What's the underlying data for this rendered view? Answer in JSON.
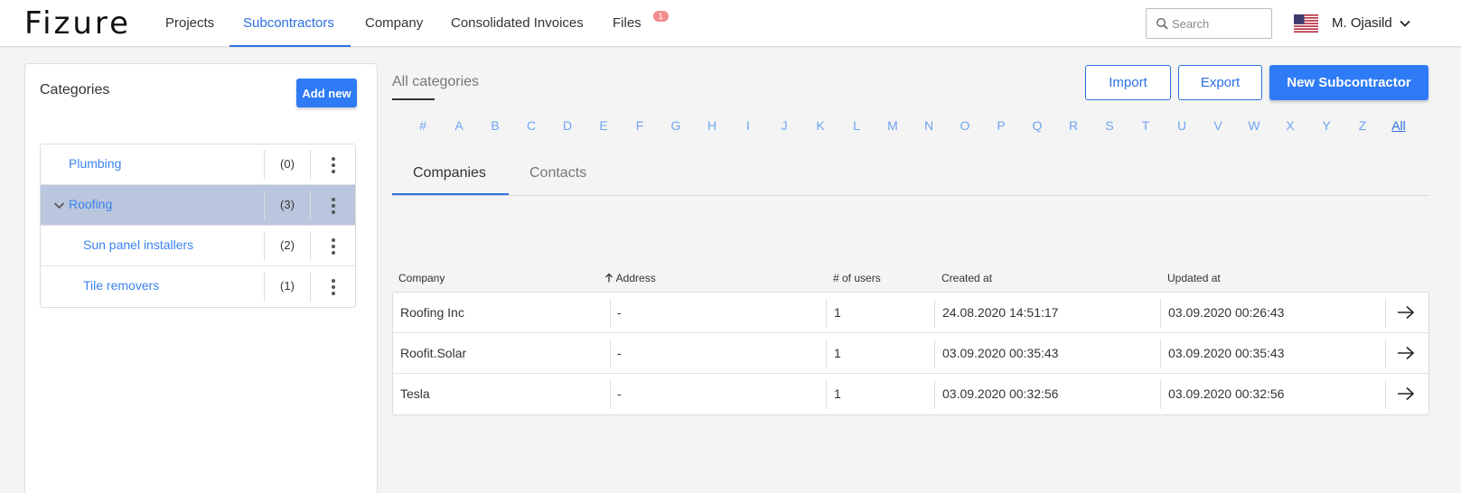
{
  "app": {
    "logo": "Fizure"
  },
  "nav": {
    "items": [
      {
        "label": "Projects"
      },
      {
        "label": "Subcontractors"
      },
      {
        "label": "Company"
      },
      {
        "label": "Consolidated Invoices"
      },
      {
        "label": "Files"
      }
    ],
    "files_badge": "1"
  },
  "search": {
    "placeholder": "Search"
  },
  "user": {
    "name": "M. Ojasild"
  },
  "sidebar": {
    "title": "Categories",
    "add_new_label": "Add new",
    "categories": [
      {
        "label": "Plumbing",
        "count": "(0)"
      },
      {
        "label": "Roofing",
        "count": "(3)"
      },
      {
        "label": "Sun panel installers",
        "count": "(2)"
      },
      {
        "label": "Tile removers",
        "count": "(1)"
      }
    ]
  },
  "main": {
    "title": "All categories",
    "import_label": "Import",
    "export_label": "Export",
    "new_label": "New Subcontractor",
    "alphabet": [
      "#",
      "A",
      "B",
      "C",
      "D",
      "E",
      "F",
      "G",
      "H",
      "I",
      "J",
      "K",
      "L",
      "M",
      "N",
      "O",
      "P",
      "Q",
      "R",
      "S",
      "T",
      "U",
      "V",
      "W",
      "X",
      "Y",
      "Z",
      "All"
    ],
    "tabs": [
      {
        "label": "Companies"
      },
      {
        "label": "Contacts"
      }
    ],
    "table": {
      "headers": [
        "Company",
        "Address",
        "# of users",
        "Created at",
        "Updated at"
      ],
      "rows": [
        {
          "company": "Roofing Inc",
          "address": "-",
          "users": "1",
          "created": "24.08.2020 14:51:17",
          "updated": "03.09.2020 00:26:43"
        },
        {
          "company": "Roofit.Solar",
          "address": "-",
          "users": "1",
          "created": "03.09.2020 00:35:43",
          "updated": "03.09.2020 00:35:43"
        },
        {
          "company": "Tesla",
          "address": "-",
          "users": "1",
          "created": "03.09.2020 00:32:56",
          "updated": "03.09.2020 00:32:56"
        }
      ]
    }
  },
  "colors": {
    "accent": "#2f7bf5",
    "link": "#3a83f0",
    "selected_row": "#b9c6de",
    "badge": "#f08c8c"
  }
}
